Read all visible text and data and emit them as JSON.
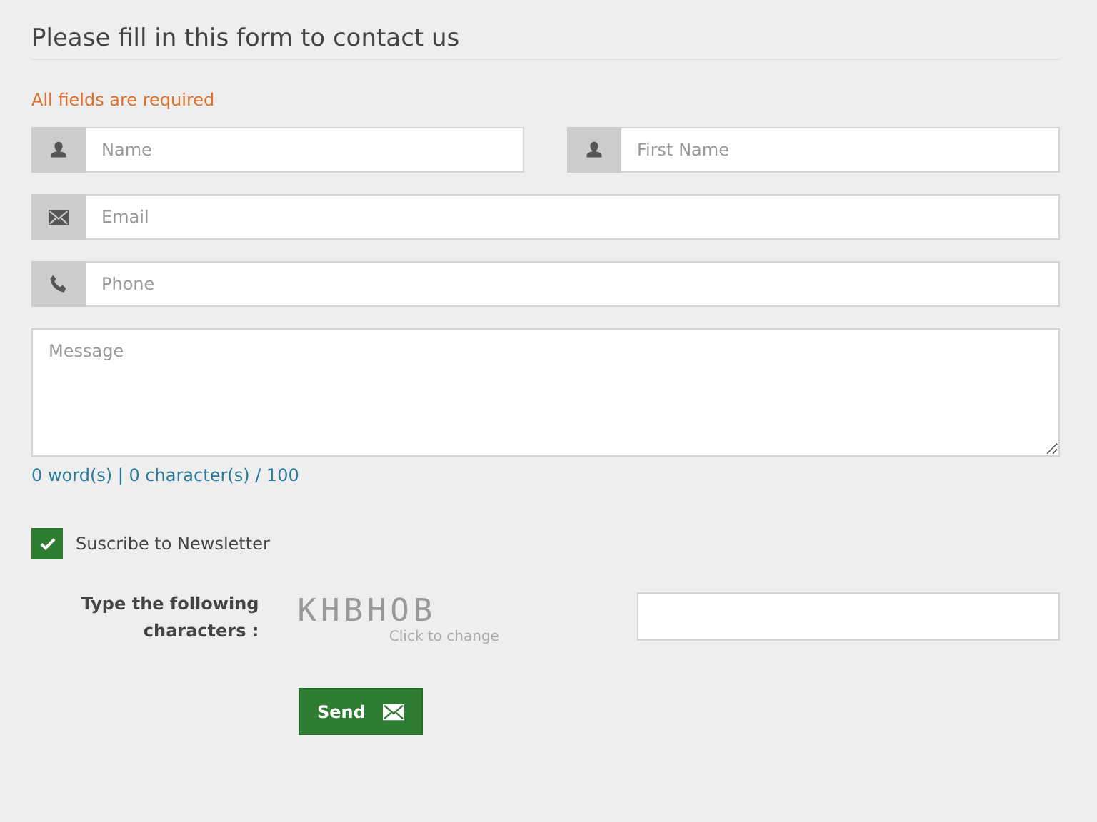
{
  "heading": "Please fill in this form to contact us",
  "required_note": "All fields are required",
  "field_rows": [
    [
      {
        "kind": "person",
        "placeholder": "Name"
      },
      {
        "kind": "person",
        "placeholder": "First Name"
      }
    ],
    [
      {
        "kind": "envelope",
        "placeholder": "Email"
      }
    ],
    [
      {
        "kind": "phone",
        "placeholder": "Phone"
      }
    ]
  ],
  "message": {
    "placeholder": "Message",
    "counter": "0 word(s) | 0 character(s) / 100"
  },
  "newsletter": {
    "label": "Suscribe to Newsletter",
    "checked": true
  },
  "captcha": {
    "label": "Type the following characters :",
    "code": "KHBHOB",
    "hint": "Click to change"
  },
  "send_button": {
    "label": "Send"
  }
}
